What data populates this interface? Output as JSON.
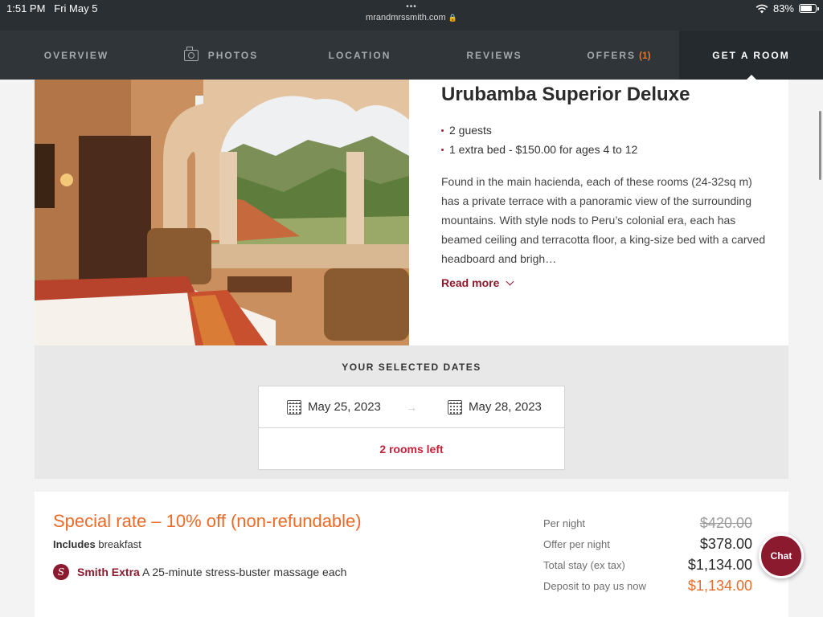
{
  "status_bar": {
    "time": "1:51 PM",
    "date": "Fri May 5",
    "url": "mrandmrssmith.com",
    "battery": "83%",
    "dots": "•••"
  },
  "nav": {
    "items": [
      {
        "label": "OVERVIEW"
      },
      {
        "label": "PHOTOS",
        "icon": "camera-icon"
      },
      {
        "label": "LOCATION"
      },
      {
        "label": "REVIEWS"
      },
      {
        "label": "OFFERS",
        "badge": "(1)"
      },
      {
        "label": "GET A ROOM",
        "active": true
      }
    ]
  },
  "room": {
    "title": "Urubamba Superior Deluxe",
    "features": [
      "2  guests",
      "1 extra bed - $150.00 for ages 4 to 12"
    ],
    "description": "Found in the main hacienda, each of these rooms (24-32sq m) has a private terrace with a panoramic view of the surrounding mountains. With style nods to Peru’s colonial era, each has beamed ceiling and terracotta floor, a king-size bed with a carved headboard and brigh…",
    "read_more": "Read more"
  },
  "dates": {
    "title": "YOUR SELECTED DATES",
    "check_in": "May 25, 2023",
    "check_out": "May 28, 2023",
    "arrow": "→",
    "rooms_left": "2 rooms left"
  },
  "rate": {
    "title": "Special rate – 10% off (non-refundable)",
    "includes_label": "Includes",
    "includes_value": "breakfast",
    "extra_logo": "S",
    "extra_name": "Smith Extra",
    "extra_text": "A 25-minute stress-buster massage each",
    "prices": [
      {
        "label": "Per night",
        "value": "$420.00",
        "style": "struck"
      },
      {
        "label": "Offer per night",
        "value": "$378.00",
        "style": "normal"
      },
      {
        "label": "Total stay (ex tax)",
        "value": "$1,134.00",
        "style": "normal"
      },
      {
        "label": "Deposit to pay us now",
        "value": "$1,134.00",
        "style": "deposit"
      }
    ]
  },
  "chat": {
    "label": "Chat"
  },
  "colors": {
    "accent_orange": "#ec6a28",
    "brand_burgundy": "#8b1a2e",
    "nav_bg": "#2f3539"
  }
}
